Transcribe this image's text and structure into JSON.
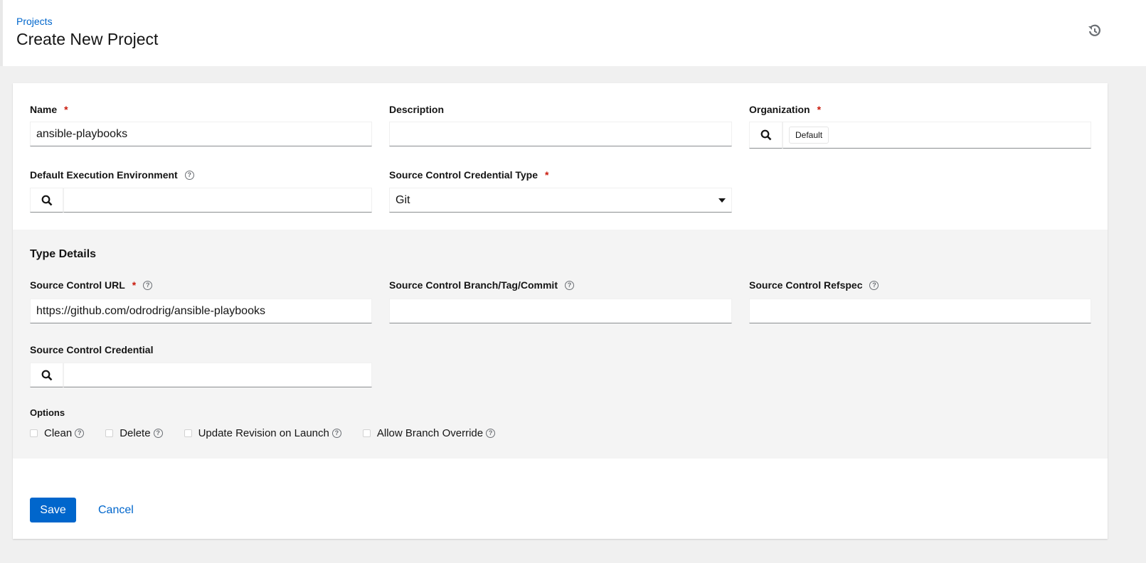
{
  "header": {
    "breadcrumb": "Projects",
    "title": "Create New Project",
    "history_icon": "history-icon"
  },
  "form": {
    "name": {
      "label": "Name",
      "value": "ansible-playbooks",
      "required": true
    },
    "description": {
      "label": "Description",
      "value": ""
    },
    "organization": {
      "label": "Organization",
      "value": "Default",
      "required": true
    },
    "execution_environment": {
      "label": "Default Execution Environment",
      "value": ""
    },
    "scm_type": {
      "label": "Source Control Credential Type",
      "value": "Git",
      "required": true
    },
    "type_details": {
      "heading": "Type Details",
      "scm_url": {
        "label": "Source Control URL",
        "value": "https://github.com/odrodrig/ansible-playbooks",
        "required": true
      },
      "scm_branch": {
        "label": "Source Control Branch/Tag/Commit",
        "value": ""
      },
      "scm_refspec": {
        "label": "Source Control Refspec",
        "value": ""
      },
      "scm_credential": {
        "label": "Source Control Credential",
        "value": ""
      },
      "options_label": "Options",
      "options": [
        {
          "label": "Clean",
          "checked": false
        },
        {
          "label": "Delete",
          "checked": false
        },
        {
          "label": "Update Revision on Launch",
          "checked": false
        },
        {
          "label": "Allow Branch Override",
          "checked": false
        }
      ]
    }
  },
  "actions": {
    "save": "Save",
    "cancel": "Cancel"
  },
  "colors": {
    "accent": "#0066cc",
    "required": "#c9190b"
  }
}
